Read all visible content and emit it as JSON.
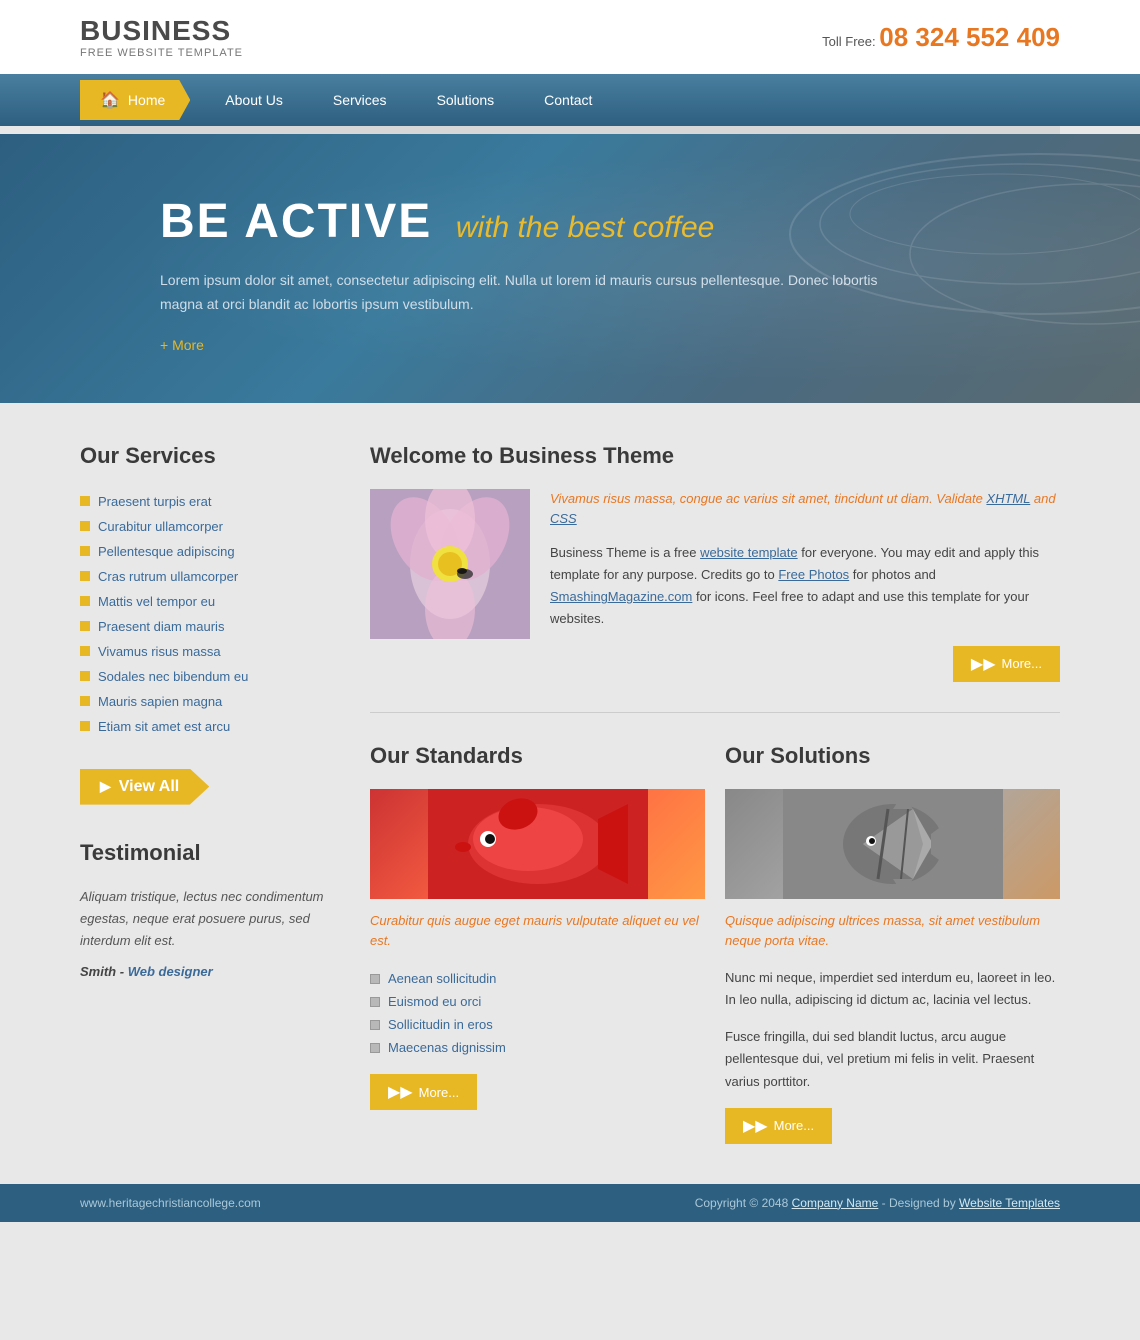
{
  "logo": {
    "title": "BUSINESS",
    "subtitle": "FREE WEBSITE TEMPLATE"
  },
  "phone": {
    "label": "Toll Free:",
    "number": "08 324 552 409"
  },
  "nav": {
    "home": "Home",
    "about": "About Us",
    "services": "Services",
    "solutions": "Solutions",
    "contact": "Contact"
  },
  "hero": {
    "main_title": "BE ACTIVE",
    "subtitle": "with the best coffee",
    "description": "Lorem ipsum dolor sit amet, consectetur adipiscing elit. Nulla ut lorem id mauris cursus pellentesque. Donec lobortis magna at orci blandit ac lobortis ipsum vestibulum.",
    "more_link": "+ More"
  },
  "services": {
    "title": "Our Services",
    "items": [
      "Praesent turpis erat",
      "Curabitur ullamcorper",
      "Pellentesque adipiscing",
      "Cras rutrum ullamcorper",
      "Mattis vel tempor eu",
      "Praesent diam mauris",
      "Vivamus risus massa",
      "Sodales nec bibendum eu",
      "Mauris sapien magna",
      "Etiam sit amet est arcu"
    ],
    "view_all": "View All"
  },
  "testimonial": {
    "title": "Testimonial",
    "text": "Aliquam tristique, lectus nec condimentum egestas, neque erat posuere purus, sed interdum elit est.",
    "author": "Smith",
    "author_role": "Web designer"
  },
  "welcome": {
    "title": "Welcome to Business Theme",
    "highlight": "Vivamus risus massa, congue ac varius sit amet, tincidunt ut diam. Validate XHTML and CSS",
    "body1": "Business Theme is a free website template for everyone. You may edit and apply this template for any purpose. Credits go to Free Photos for photos and SmashingMagazine.com for icons. Feel free to adapt and use this template for your websites.",
    "more_label": "More..."
  },
  "standards": {
    "title": "Our Standards",
    "caption": "Curabitur quis augue eget mauris vulputate aliquet eu vel est.",
    "items": [
      "Aenean sollicitudin",
      "Euismod eu orci",
      "Sollicitudin in eros",
      "Maecenas dignissim"
    ],
    "more_label": "More..."
  },
  "solutions": {
    "title": "Our Solutions",
    "caption": "Quisque adipiscing ultrices massa, sit amet vestibulum neque porta vitae.",
    "body1": "Nunc mi neque, imperdiet sed interdum eu, laoreet in leo. In leo nulla, adipiscing id dictum ac, lacinia vel lectus.",
    "body2": "Fusce fringilla, dui sed blandit luctus, arcu augue pellentesque dui, vel pretium mi felis in velit. Praesent varius porttitor.",
    "more_label": "More..."
  },
  "footer": {
    "website": "www.heritagechristiancollege.com",
    "copyright": "Copyright © 2048",
    "company_name": "Company Name",
    "designed_by": "- Designed by",
    "templates_link": "Website Templates"
  }
}
